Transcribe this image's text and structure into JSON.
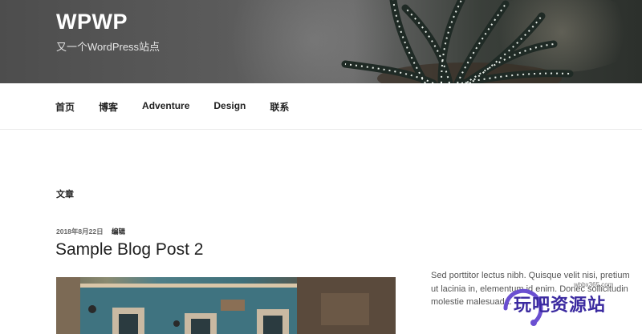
{
  "site": {
    "title": "WPWP",
    "description": "又一个WordPress站点"
  },
  "nav": {
    "items": [
      "首页",
      "博客",
      "Adventure",
      "Design",
      "联系"
    ]
  },
  "main": {
    "heading": "文章",
    "post": {
      "date": "2018年8月22日",
      "edit_label": "编辑",
      "title": "Sample Blog Post 2"
    }
  },
  "sidebar": {
    "text": "Sed porttitor lectus nibh. Quisque velit nisi, pretium ut lacinia in, elementum id enim. Donec sollicitudin molestie malesuada."
  },
  "watermark": {
    "small": "wbbx365.com",
    "text": "玩吧资源站"
  }
}
